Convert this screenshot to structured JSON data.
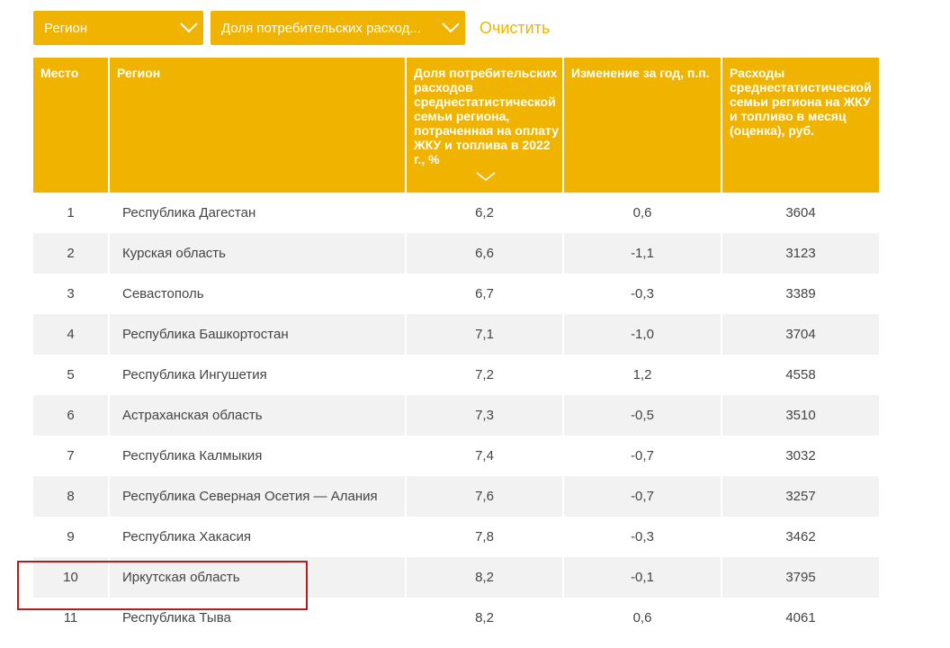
{
  "filters": {
    "region_label": "Регион",
    "share_label": "Доля потребительских расход...",
    "clear_label": "Очистить"
  },
  "colors": {
    "accent": "#f0b400",
    "row_alt": "#f2f2f2",
    "highlight": "#b71c1c"
  },
  "table": {
    "headers": {
      "place": "Место",
      "region": "Регион",
      "share": "Доля потребительских расходов среднестатистической семьи региона, потраченная на оплату ЖКУ и топлива в 2022 г., %",
      "change": "Изменение за год, п.п.",
      "spending": "Расходы среднестатистической семьи региона на ЖКУ и топливо в месяц (оценка), руб."
    },
    "sort_icon": "chevron-down-icon",
    "rows": [
      {
        "place": "1",
        "region": "Республика Дагестан",
        "share": "6,2",
        "change": "0,6",
        "spending": "3604"
      },
      {
        "place": "2",
        "region": "Курская область",
        "share": "6,6",
        "change": "-1,1",
        "spending": "3123"
      },
      {
        "place": "3",
        "region": "Севастополь",
        "share": "6,7",
        "change": "-0,3",
        "spending": "3389"
      },
      {
        "place": "4",
        "region": "Республика Башкортостан",
        "share": "7,1",
        "change": "-1,0",
        "spending": "3704"
      },
      {
        "place": "5",
        "region": "Республика Ингушетия",
        "share": "7,2",
        "change": "1,2",
        "spending": "4558"
      },
      {
        "place": "6",
        "region": "Астраханская область",
        "share": "7,3",
        "change": "-0,5",
        "spending": "3510"
      },
      {
        "place": "7",
        "region": "Республика Калмыкия",
        "share": "7,4",
        "change": "-0,7",
        "spending": "3032"
      },
      {
        "place": "8",
        "region": "Республика Северная Осетия — Алания",
        "share": "7,6",
        "change": "-0,7",
        "spending": "3257"
      },
      {
        "place": "9",
        "region": "Республика Хакасия",
        "share": "7,8",
        "change": "-0,3",
        "spending": "3462"
      },
      {
        "place": "10",
        "region": "Иркутская область",
        "share": "8,2",
        "change": "-0,1",
        "spending": "3795"
      },
      {
        "place": "11",
        "region": "Республика Тыва",
        "share": "8,2",
        "change": "0,6",
        "spending": "4061"
      }
    ]
  }
}
